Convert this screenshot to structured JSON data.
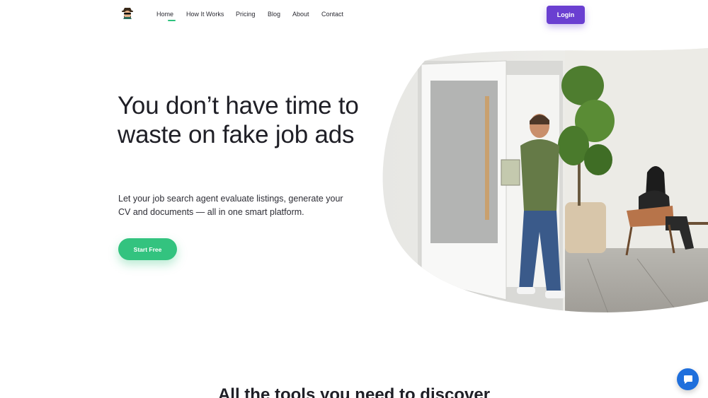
{
  "nav": {
    "items": [
      {
        "label": "Home",
        "active": true
      },
      {
        "label": "How It Works",
        "active": false
      },
      {
        "label": "Pricing",
        "active": false
      },
      {
        "label": "Blog",
        "active": false
      },
      {
        "label": "About",
        "active": false
      },
      {
        "label": "Contact",
        "active": false
      }
    ],
    "login_label": "Login",
    "logo_icon": "spy-logo-icon"
  },
  "hero": {
    "title": "You don’t have time to waste on fake job ads",
    "subtitle": "Let your job search agent evaluate listings, generate your CV and documents — all in one smart platform.",
    "cta_label": "Start Free",
    "image_icon": "office-photo"
  },
  "tools": {
    "title": "All the tools you need to discover"
  },
  "chat": {
    "icon": "chat-bubble-icon"
  },
  "colors": {
    "accent_green": "#33c37f",
    "accent_purple": "#6a3fd1",
    "chat_blue": "#1f6fdc"
  }
}
